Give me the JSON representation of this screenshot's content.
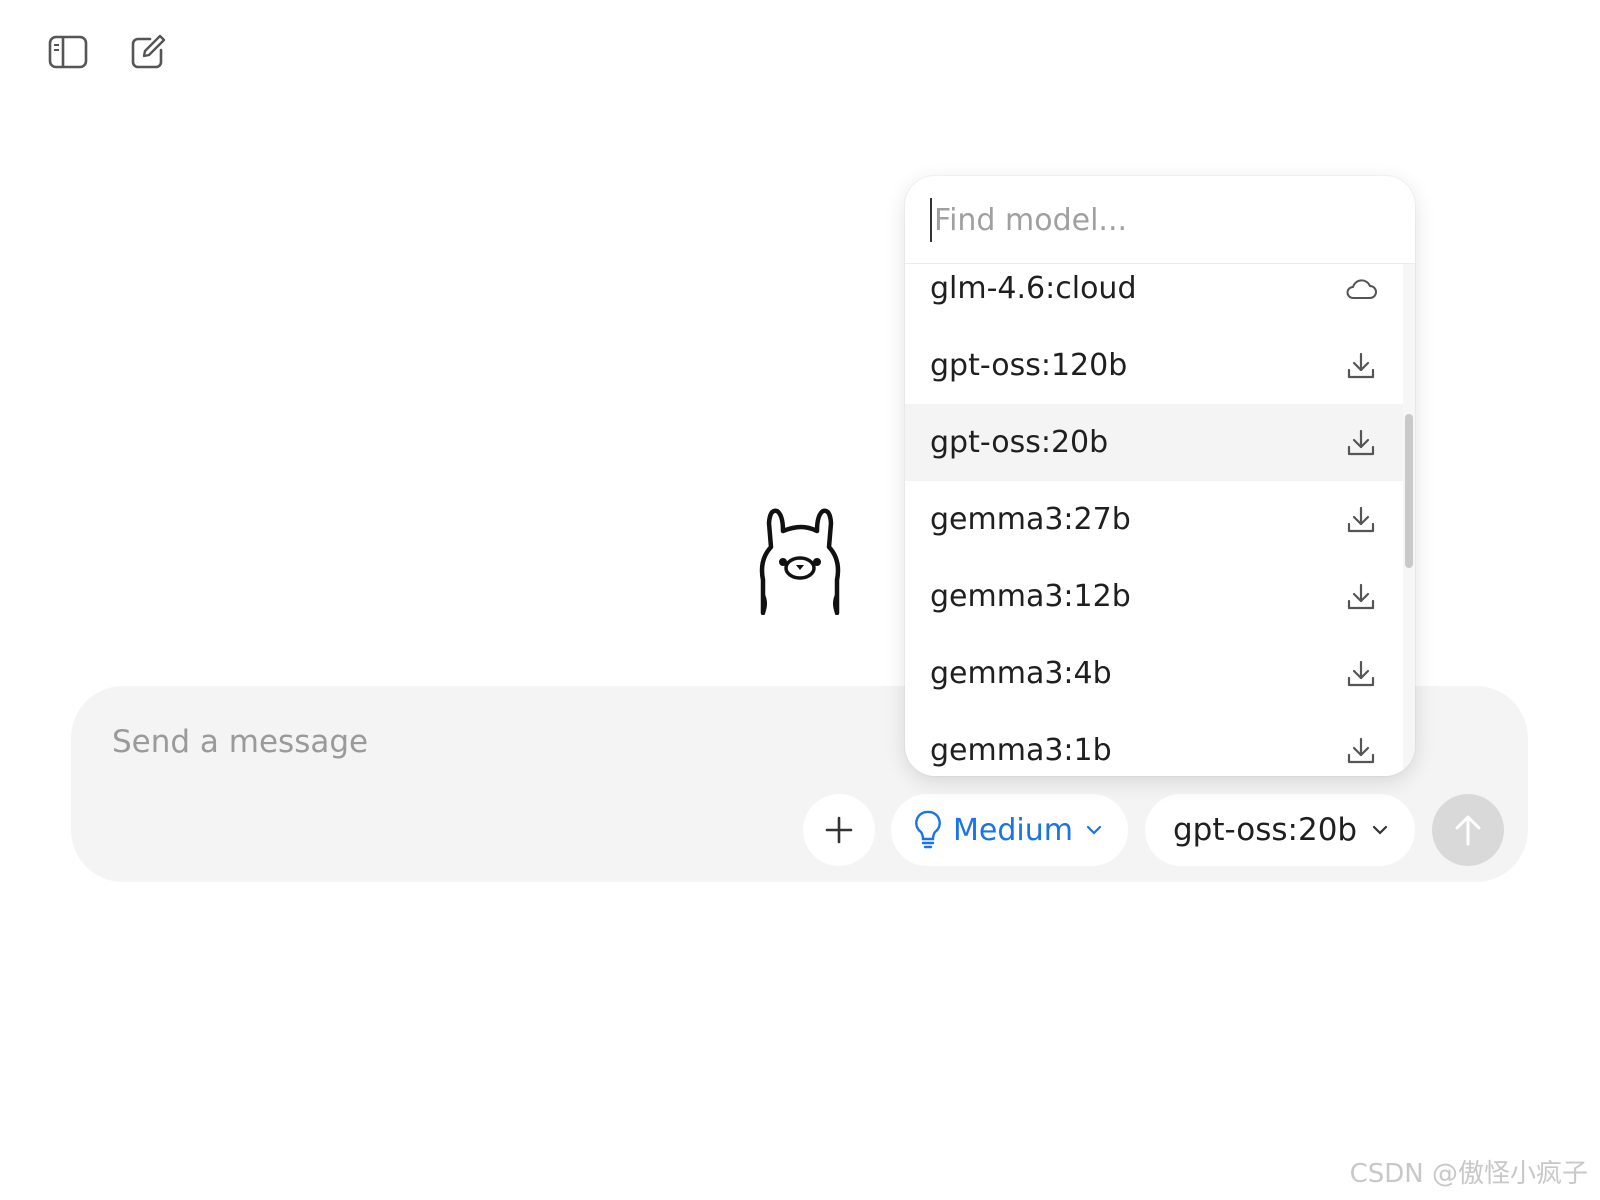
{
  "toolbar": {
    "sidebar_icon": "sidebar-toggle-icon",
    "new_chat_icon": "new-chat-icon"
  },
  "composer": {
    "placeholder": "Send a message",
    "add_icon": "plus-icon",
    "think_level": "Medium",
    "think_icon": "lightbulb-icon",
    "selected_model": "gpt-oss:20b",
    "send_icon": "arrow-up-icon"
  },
  "model_picker": {
    "search_placeholder": "Find model...",
    "models": [
      {
        "name": "glm-4.6:cloud",
        "icon": "cloud-icon"
      },
      {
        "name": "gpt-oss:120b",
        "icon": "download-icon"
      },
      {
        "name": "gpt-oss:20b",
        "icon": "download-icon",
        "highlighted": true
      },
      {
        "name": "gemma3:27b",
        "icon": "download-icon"
      },
      {
        "name": "gemma3:12b",
        "icon": "download-icon"
      },
      {
        "name": "gemma3:4b",
        "icon": "download-icon"
      },
      {
        "name": "gemma3:1b",
        "icon": "download-icon"
      }
    ]
  },
  "colors": {
    "accent": "#1a73e8",
    "composer_bg": "#f4f4f4",
    "send_disabled": "#d9d9d9"
  },
  "watermark": "CSDN @傲怪小疯子"
}
